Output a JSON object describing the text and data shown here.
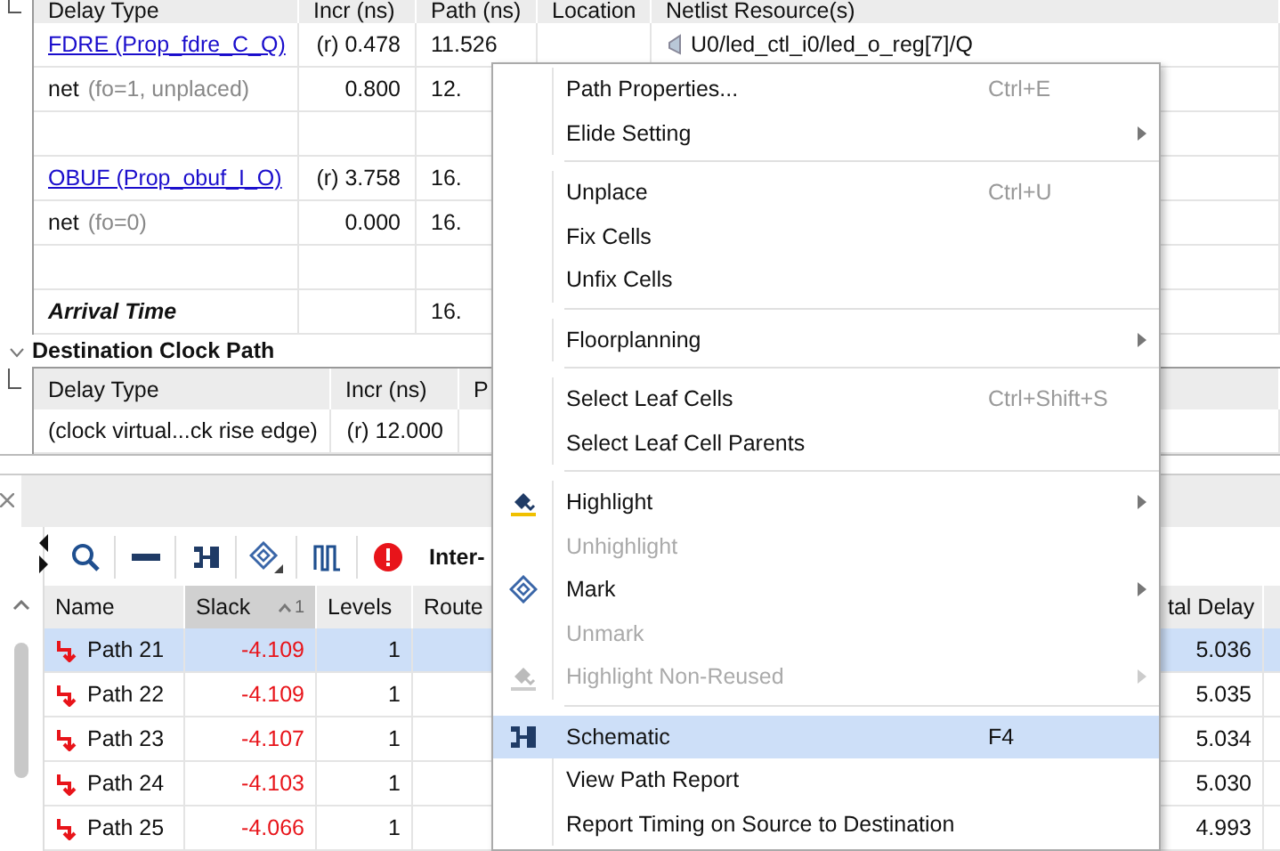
{
  "path_table": {
    "columns": [
      "Delay Type",
      "Incr (ns)",
      "Path (ns)",
      "Location",
      "Netlist Resource(s)"
    ],
    "rows": [
      {
        "kind": "link",
        "delay_type": "FDRE (Prop_fdre_C_Q)",
        "incr": "(r) 0.478",
        "path": "11.526",
        "netlist": "U0/led_ctl_i0/led_o_reg[7]/Q"
      },
      {
        "kind": "net",
        "delay_type": "net",
        "detail": "(fo=1, unplaced)",
        "incr": "0.800",
        "path": "12."
      },
      {
        "kind": "blank"
      },
      {
        "kind": "link",
        "delay_type": "OBUF (Prop_obuf_I_O)",
        "incr": "(r) 3.758",
        "path": "16."
      },
      {
        "kind": "net",
        "delay_type": "net",
        "detail": "(fo=0)",
        "incr": "0.000",
        "path": "16."
      },
      {
        "kind": "blank"
      },
      {
        "kind": "total",
        "delay_type": "Arrival Time",
        "path": "16."
      }
    ]
  },
  "destination_section": {
    "title": "Destination Clock Path",
    "expanded": true,
    "columns": [
      "Delay Type",
      "Incr (ns)",
      "P"
    ],
    "rows": [
      {
        "delay_type": "(clock virtual...ck rise edge)",
        "incr": "(r) 12.000"
      }
    ]
  },
  "toolbar": {
    "label": "Inter-"
  },
  "paths_table": {
    "columns": [
      {
        "label": "Name",
        "sorted": false
      },
      {
        "label": "Slack",
        "sorted": true,
        "sort_rank": "1"
      },
      {
        "label": "Levels",
        "sorted": false
      },
      {
        "label": "Route",
        "sorted": false
      },
      {
        "label": "tal Delay",
        "sorted": false
      }
    ],
    "rows": [
      {
        "name": "Path 21",
        "slack": "-4.109",
        "levels": "1",
        "total_delay": "5.036",
        "selected": true
      },
      {
        "name": "Path 22",
        "slack": "-4.109",
        "levels": "1",
        "total_delay": "5.035",
        "selected": false
      },
      {
        "name": "Path 23",
        "slack": "-4.107",
        "levels": "1",
        "total_delay": "5.034",
        "selected": false
      },
      {
        "name": "Path 24",
        "slack": "-4.103",
        "levels": "1",
        "total_delay": "5.030",
        "selected": false
      },
      {
        "name": "Path 25",
        "slack": "-4.066",
        "levels": "1",
        "total_delay": "4.993",
        "selected": false
      }
    ]
  },
  "context_menu": {
    "items": [
      {
        "kind": "item",
        "label": "Path Properties...",
        "shortcut": "Ctrl+E",
        "submenu": false,
        "disabled": false,
        "selected": false
      },
      {
        "kind": "item",
        "label": "Elide Setting",
        "submenu": true,
        "disabled": false,
        "selected": false
      },
      {
        "kind": "separator"
      },
      {
        "kind": "item",
        "label": "Unplace",
        "shortcut": "Ctrl+U",
        "submenu": false,
        "disabled": false,
        "selected": false
      },
      {
        "kind": "item",
        "label": "Fix Cells",
        "submenu": false,
        "disabled": false,
        "selected": false
      },
      {
        "kind": "item",
        "label": "Unfix Cells",
        "submenu": false,
        "disabled": false,
        "selected": false
      },
      {
        "kind": "separator"
      },
      {
        "kind": "item",
        "label": "Floorplanning",
        "submenu": true,
        "disabled": false,
        "selected": false
      },
      {
        "kind": "separator"
      },
      {
        "kind": "item",
        "label": "Select Leaf Cells",
        "shortcut": "Ctrl+Shift+S",
        "submenu": false,
        "disabled": false,
        "selected": false
      },
      {
        "kind": "item",
        "label": "Select Leaf Cell Parents",
        "submenu": false,
        "disabled": false,
        "selected": false
      },
      {
        "kind": "separator"
      },
      {
        "kind": "highlight",
        "label": "Highlight",
        "submenu": true,
        "disabled": false,
        "selected": false
      },
      {
        "kind": "item",
        "label": "Unhighlight",
        "submenu": false,
        "disabled": true,
        "selected": false
      },
      {
        "kind": "mark",
        "label": "Mark",
        "submenu": true,
        "disabled": false,
        "selected": false
      },
      {
        "kind": "item",
        "label": "Unmark",
        "submenu": false,
        "disabled": true,
        "selected": false
      },
      {
        "kind": "highlight",
        "label": "Highlight Non-Reused",
        "submenu": true,
        "disabled": true,
        "selected": false
      },
      {
        "kind": "separator"
      },
      {
        "kind": "schematic",
        "label": "Schematic",
        "shortcut": "F4",
        "submenu": false,
        "disabled": false,
        "selected": true
      },
      {
        "kind": "item",
        "label": "View Path Report",
        "submenu": false,
        "disabled": false,
        "selected": false
      },
      {
        "kind": "item",
        "label": "Report Timing on Source to Destination",
        "submenu": false,
        "disabled": false,
        "selected": false
      }
    ]
  }
}
